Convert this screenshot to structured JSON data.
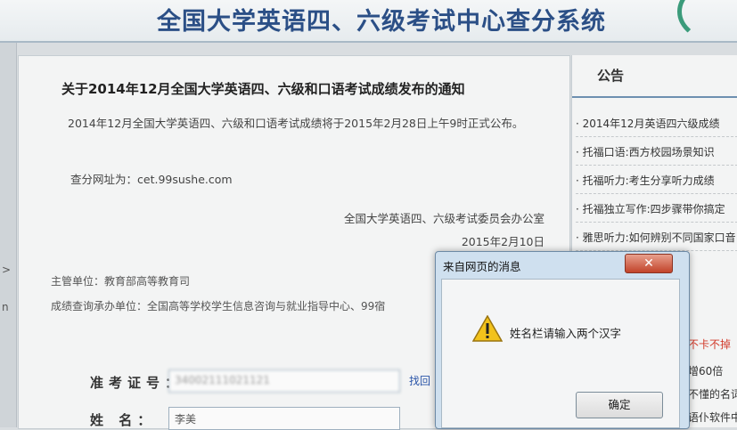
{
  "header": {
    "title": "全国大学英语四、六级考试中心查分系统"
  },
  "notice": {
    "title": "关于2014年12月全国大学英语四、六级和口语考试成绩发布的通知",
    "body": "2014年12月全国大学英语四、六级和口语考试成绩将于2015年2月28日上午9时正式公布。",
    "url_line": "查分网址为：cet.99sushe.com",
    "signature": "全国大学英语四、六级考试委员会办公室",
    "date": "2015年2月10日"
  },
  "org": {
    "sponsor": "主管单位：教育部高等教育司",
    "operator": "成绩查询承办单位：全国高等学校学生信息咨询与就业指导中心、99宿"
  },
  "form": {
    "exam_id_label": "准考证号：",
    "exam_id_value": "34002111021121",
    "find_label": "找回",
    "name_label": "姓 名：",
    "name_value": "李美"
  },
  "sidebar": {
    "title": "公告",
    "items": [
      "· 2014年12月英语四六级成绩",
      "· 托福口语:西方校园场景知识",
      "· 托福听力:考生分享听力成绩",
      "· 托福独立写作:四步骤带你搞定",
      "· 雅思听力:如何辨别不同国家口音"
    ],
    "tail": [
      "不卡不掉",
      "增60倍",
      "不懂的名词",
      "语仆软件中"
    ]
  },
  "dialog": {
    "title": "来自网页的消息",
    "close_label": "✕",
    "message": "姓名栏请输入两个汉字",
    "ok_label": "确定"
  },
  "colors": {
    "title_blue": "#2b4f86",
    "dialog_frame": "#cfe0ef",
    "close_red": "#c2432a",
    "tail_red": "#d23a2a"
  },
  "icons": {
    "warning": "warning-icon",
    "close": "close-icon"
  }
}
